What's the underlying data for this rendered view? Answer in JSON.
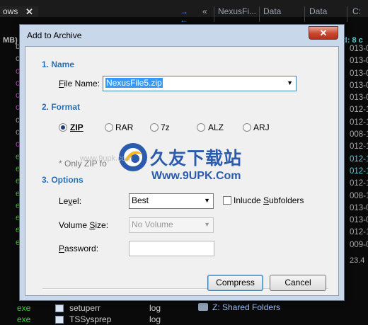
{
  "background": {
    "left_tab": "ows",
    "tabs": [
      "NexusFi...",
      "Data",
      "Data",
      "C:"
    ],
    "arrows": "→\n←",
    "double_chevron": "«",
    "left_header": "MB)",
    "right_header": "d: 8 c",
    "date_cells": [
      "013-0",
      "013-0",
      "013-0",
      "013-0",
      "013-0",
      "012-1",
      "012-1",
      "008-1",
      "012-1",
      "012-1",
      "012-1",
      "012-1",
      "008-1",
      "013-0",
      "013-0",
      "012-1",
      "009-0"
    ],
    "left_cells": [
      "b",
      "c",
      "c",
      "c",
      "c",
      "c",
      "c",
      "c",
      "c",
      "e",
      "e",
      "e",
      "e",
      "e",
      "e",
      "e",
      "e"
    ],
    "size_value": "23.4",
    "rows": [
      {
        "ext": "exe",
        "name": "setuperr",
        "type": "log"
      },
      {
        "ext": "exe",
        "name": "TSSysprep",
        "type": "log"
      }
    ],
    "shared_folders": "Z: Shared Folders"
  },
  "dialog": {
    "title": "Add to Archive",
    "close_glyph": "✕",
    "name_section": "1. Name",
    "file_name_label_pre": "",
    "file_name_label_u": "F",
    "file_name_label_post": "ile Name:",
    "file_name_value": "NexusFile5.zip",
    "format_section": "2. Format",
    "formats": [
      "ZIP",
      "RAR",
      "7z",
      "ALZ",
      "ARJ"
    ],
    "selected_format": "ZIP",
    "note": "* Only ZIP fo",
    "options_section": "3. Options",
    "level_label_pre": "Le",
    "level_label_u": "v",
    "level_label_post": "el:",
    "level_value": "Best",
    "include_subfolders_pre": "Inlucde ",
    "include_subfolders_u": "S",
    "include_subfolders_post": "ubfolders",
    "include_subfolders_checked": false,
    "volume_size_label_pre": "Volume ",
    "volume_size_label_u": "S",
    "volume_size_label_post": "ize:",
    "volume_size_value": "No Volume",
    "password_label_pre": "",
    "password_label_u": "P",
    "password_label_post": "assword:",
    "password_value": "",
    "compress_button": "Compress",
    "cancel_button": "Cancel"
  },
  "watermark": {
    "chinese": "久友下载站",
    "url": "Www.9UPK.Com",
    "faint_url": "www.9upk.com"
  },
  "colors": {
    "section_heading": "#2a6fb7",
    "selection": "#3399ff",
    "title_bar": "#c9d7ea",
    "close_button": "#c8472f",
    "exe_text": "#3fcf3f",
    "date_text_cyan": "#5ad1d6"
  }
}
